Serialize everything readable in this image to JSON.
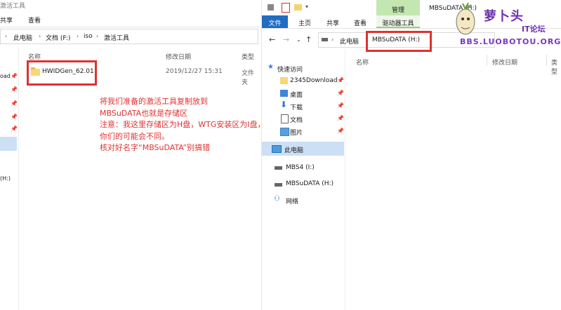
{
  "left_window": {
    "title_partial": "激活工具",
    "ribbon": [
      "共享",
      "查看"
    ],
    "breadcrumb": [
      "此电脑",
      "文档 (F:)",
      "iso",
      "激活工具"
    ],
    "columns": [
      "名称",
      "修改日期",
      "类型"
    ],
    "file": {
      "name": "HWIDGen_62.01",
      "date": "2019/12/27 15:31",
      "type": "文件夹"
    },
    "nav_partial": [
      "oad",
      "(H:)"
    ]
  },
  "annotation": {
    "lines": [
      "将我们准备的激活工具复制放到",
      "MBSuDATA也就是存储区",
      "注意：我这里存储区为H盘，WTG安装区为I盘，",
      "你们的可能会不同。",
      "核对好名字“MBSuDATA”别搞错"
    ],
    "color": "#e03131"
  },
  "right_window": {
    "title": "MBSuDATA (H:)",
    "manage_tab": "管理",
    "ribbon_tabs": [
      "文件",
      "主页",
      "共享",
      "查看"
    ],
    "drive_tools_tab": "驱动器工具",
    "breadcrumb": [
      "此电脑",
      "MBSuDATA (H:)"
    ],
    "columns": [
      "名称",
      "修改日期",
      "类型"
    ],
    "sidebar": {
      "quick_access": "快速访问",
      "pinned": [
        "2345Download",
        "桌面",
        "下载",
        "文档",
        "图片"
      ],
      "this_pc": "此电脑",
      "drives": [
        "MBS4 (I:)",
        "MBSuDATA (H:)"
      ],
      "network": "网络"
    }
  },
  "watermark": {
    "title": "萝卜头",
    "subtitle": "IT论坛",
    "url": "BBS.LUOBOTOU.ORG"
  }
}
